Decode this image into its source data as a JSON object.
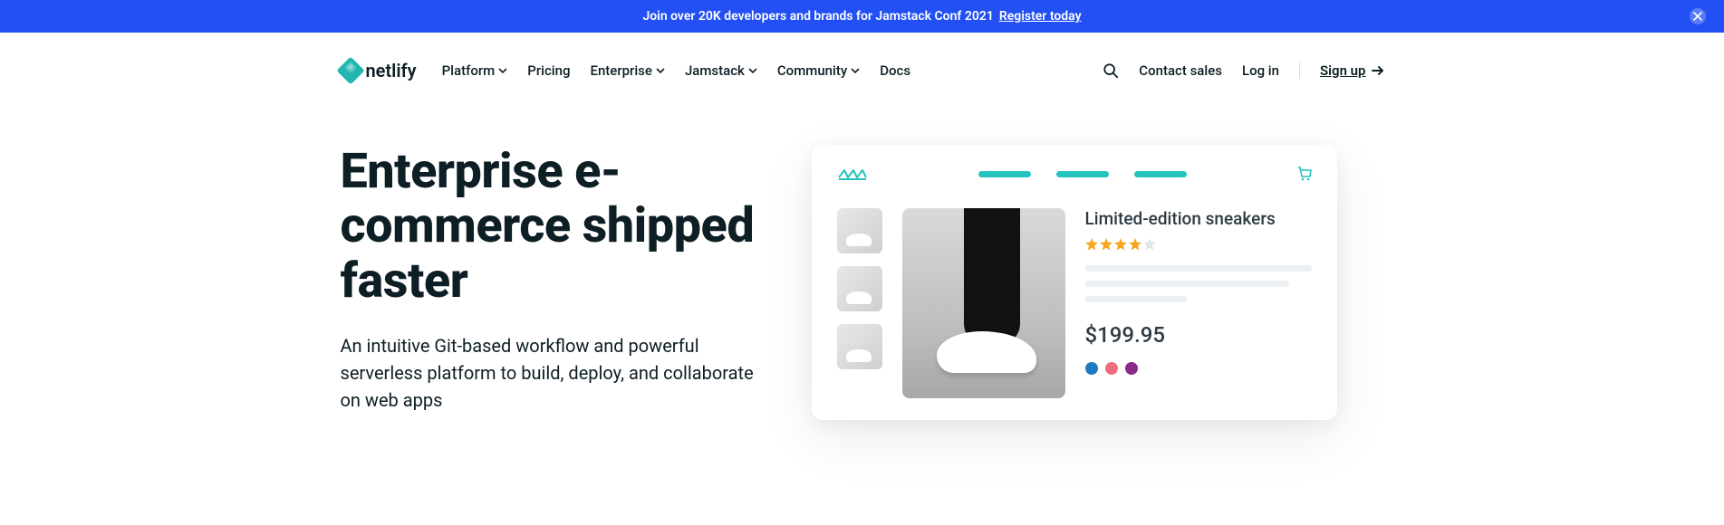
{
  "banner": {
    "text": "Join over 20K developers and brands for Jamstack Conf 2021",
    "link_label": "Register today"
  },
  "brand": "netlify",
  "nav": {
    "items": [
      {
        "label": "Platform",
        "dropdown": true
      },
      {
        "label": "Pricing",
        "dropdown": false
      },
      {
        "label": "Enterprise",
        "dropdown": true
      },
      {
        "label": "Jamstack",
        "dropdown": true
      },
      {
        "label": "Community",
        "dropdown": true
      },
      {
        "label": "Docs",
        "dropdown": false
      }
    ]
  },
  "header_right": {
    "contact": "Contact sales",
    "login": "Log in",
    "signup": "Sign up"
  },
  "hero": {
    "title": "Enterprise e-commerce shipped faster",
    "subtitle": "An intuitive Git-based workflow and powerful serverless platform to build, deploy, and collaborate on web apps"
  },
  "product_mock": {
    "title": "Limited-edition sneakers",
    "rating": 4,
    "rating_max": 5,
    "price": "$199.95",
    "swatches": [
      "#1f7bbf",
      "#f06e7c",
      "#8a2a8a"
    ],
    "accent": "#23c4bd",
    "star_color": "#f6a623"
  }
}
